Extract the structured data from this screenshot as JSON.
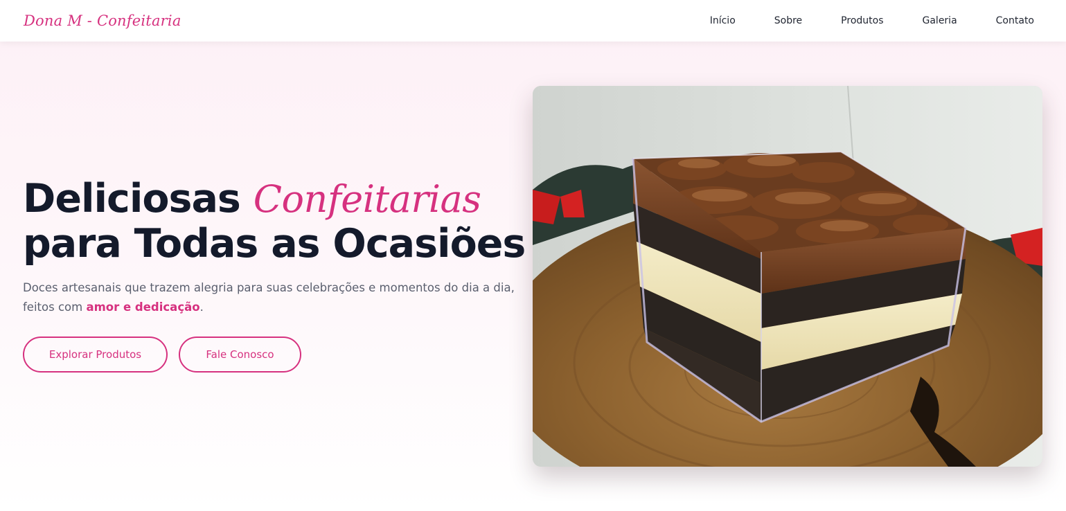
{
  "header": {
    "logo": "Dona M - Confeitaria",
    "nav": [
      {
        "label": "Início"
      },
      {
        "label": "Sobre"
      },
      {
        "label": "Produtos"
      },
      {
        "label": "Galeria"
      },
      {
        "label": "Contato"
      }
    ]
  },
  "hero": {
    "title_part1": "Deliciosas",
    "title_highlight": "Confeitarias",
    "title_part2": "para Todas as Ocasiões",
    "subtitle_text": "Doces artesanais que trazem alegria para suas celebrações e momentos do dia a dia, feitos com",
    "subtitle_emphasis": "amor e dedicação",
    "subtitle_end": ".",
    "buttons": {
      "explore": "Explorar Produtos",
      "contact": "Fale Conosco"
    }
  },
  "colors": {
    "accent": "#d6317f",
    "heading": "#141a2b",
    "body_text": "#5a5f6e"
  }
}
